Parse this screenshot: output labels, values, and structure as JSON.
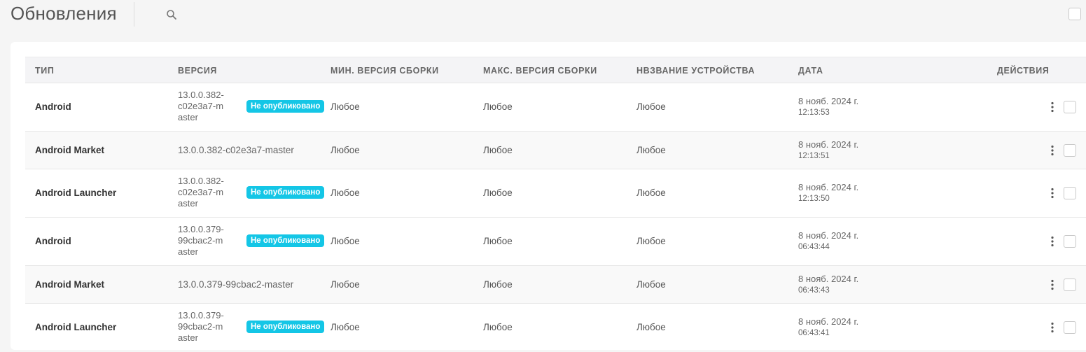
{
  "header": {
    "title": "Обновления",
    "search_icon": "search-icon"
  },
  "table": {
    "columns": [
      "ТИП",
      "ВЕРСИЯ",
      "МИН. ВЕРСИЯ СБОРКИ",
      "МАКС. ВЕРСИЯ СБОРКИ",
      "НВЗВАНИЕ УСТРОЙСТВА",
      "ДАТА",
      "ДЕЙСТВИЯ"
    ],
    "rows": [
      {
        "type": "Android",
        "version": "13.0.0.382-c02e3a7-master",
        "badge": "Не опубликовано",
        "min": "Любое",
        "max": "Любое",
        "device": "Любое",
        "date": "8 нояб. 2024 г.",
        "time": "12:13:53"
      },
      {
        "type": "Android Market",
        "version": "13.0.0.382-c02e3a7-master",
        "badge": "",
        "min": "Любое",
        "max": "Любое",
        "device": "Любое",
        "date": "8 нояб. 2024 г.",
        "time": "12:13:51"
      },
      {
        "type": "Android Launcher",
        "version": "13.0.0.382-c02e3a7-master",
        "badge": "Не опубликовано",
        "min": "Любое",
        "max": "Любое",
        "device": "Любое",
        "date": "8 нояб. 2024 г.",
        "time": "12:13:50"
      },
      {
        "type": "Android",
        "version": "13.0.0.379-99cbac2-master",
        "badge": "Не опубликовано",
        "min": "Любое",
        "max": "Любое",
        "device": "Любое",
        "date": "8 нояб. 2024 г.",
        "time": "06:43:44"
      },
      {
        "type": "Android Market",
        "version": "13.0.0.379-99cbac2-master",
        "badge": "",
        "min": "Любое",
        "max": "Любое",
        "device": "Любое",
        "date": "8 нояб. 2024 г.",
        "time": "06:43:43"
      },
      {
        "type": "Android Launcher",
        "version": "13.0.0.379-99cbac2-master",
        "badge": "Не опубликовано",
        "min": "Любое",
        "max": "Любое",
        "device": "Любое",
        "date": "8 нояб. 2024 г.",
        "time": "06:43:41"
      }
    ]
  },
  "colors": {
    "badge": "#14c6e6",
    "background": "#f5f5f5"
  }
}
